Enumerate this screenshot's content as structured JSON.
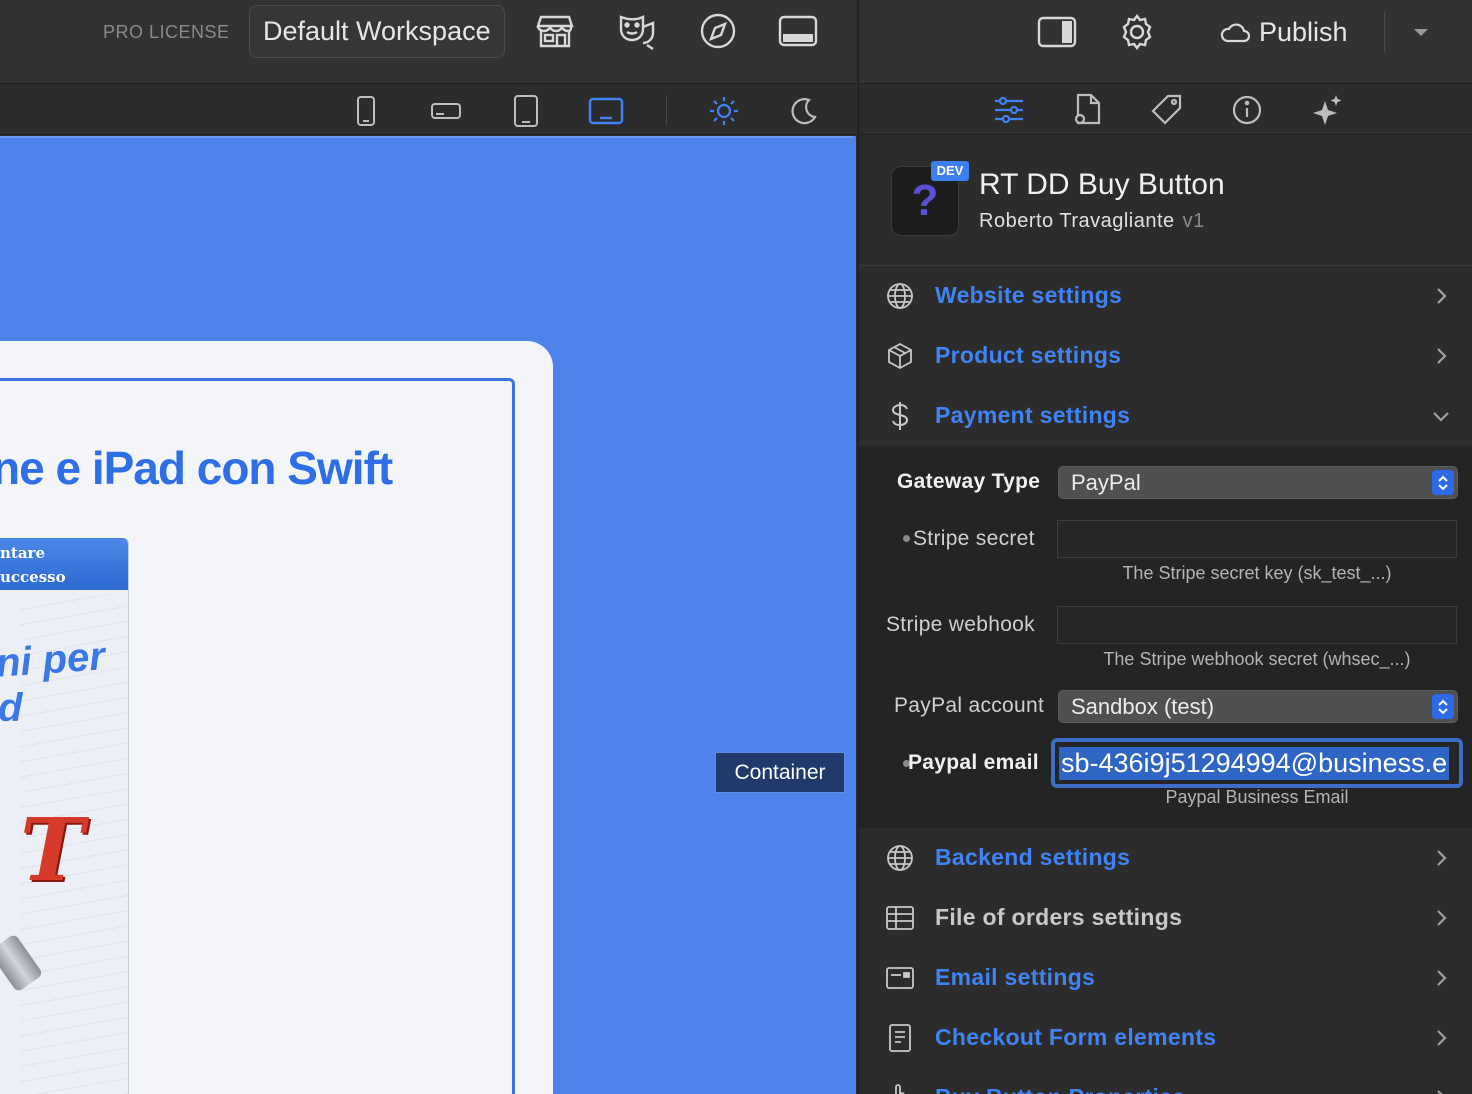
{
  "app": {
    "license": "PRO LICENSE",
    "workspace": "Default Workspace",
    "publish_label": "Publish"
  },
  "canvas": {
    "headline": "ne e iPad con Swift",
    "book": {
      "head_line1": "ntare",
      "head_line2": "uccesso",
      "blue_text": "ni per",
      "blue_text2": "d",
      "letter": "T"
    },
    "tooltip": "Container"
  },
  "component": {
    "badge": "DEV",
    "icon_glyph": "?",
    "title": "RT DD Buy Button",
    "author": "Roberto Travagliante",
    "version": "v1"
  },
  "sections": {
    "website": "Website settings",
    "product": "Product settings",
    "payment": "Payment settings",
    "backend": "Backend settings",
    "orders": "File of orders settings",
    "email": "Email settings",
    "checkout": "Checkout Form elements",
    "buy_button": "Buy Button Properties"
  },
  "payment": {
    "gateway_label": "Gateway Type",
    "gateway_value": "PayPal",
    "stripe_secret_label": "Stripe secret",
    "stripe_secret_value": "",
    "stripe_secret_help": "The Stripe secret key (sk_test_...)",
    "stripe_webhook_label": "Stripe webhook",
    "stripe_webhook_value": "",
    "stripe_webhook_help": "The Stripe webhook secret (whsec_...)",
    "paypal_account_label": "PayPal account",
    "paypal_account_value": "Sandbox (test)",
    "paypal_email_label": "Paypal email",
    "paypal_email_value": "sb-436i9j51294994@business.e",
    "paypal_email_help": "Paypal Business Email"
  },
  "colors": {
    "accent": "#3f83f4",
    "canvas_blue": "#4f82ea",
    "panel_bg": "#2c2c2c",
    "headline_blue": "#2f6fe6"
  }
}
